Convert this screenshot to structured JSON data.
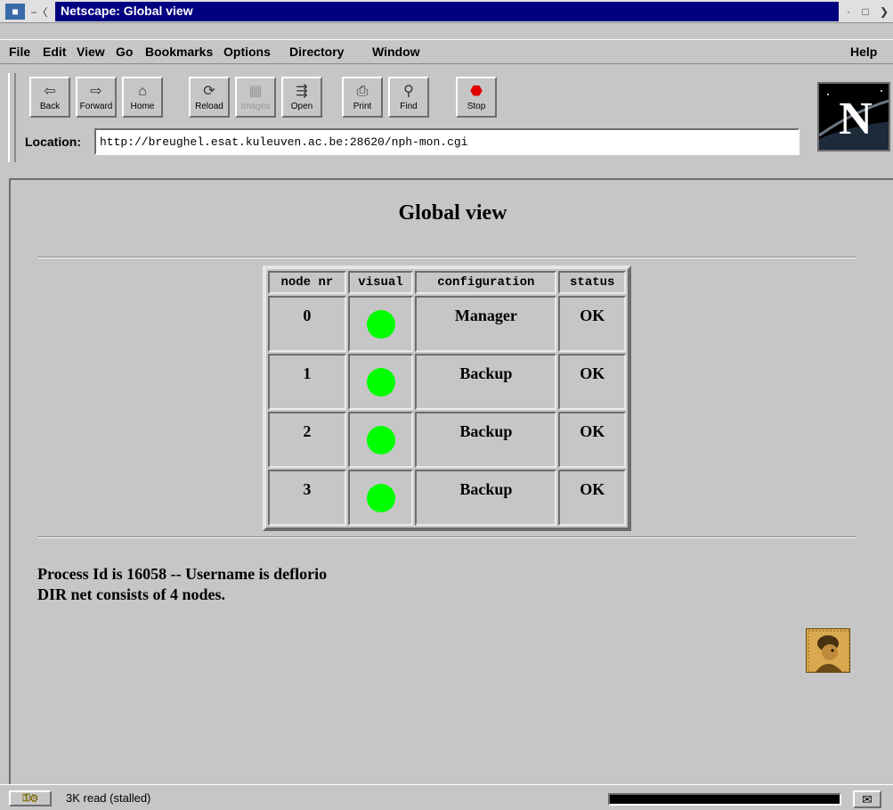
{
  "window": {
    "title": "Netscape: Global view"
  },
  "menubar": {
    "items": [
      "File",
      "Edit",
      "View",
      "Go",
      "Bookmarks",
      "Options",
      "Directory",
      "Window"
    ],
    "help": "Help"
  },
  "toolbar": {
    "buttons": [
      {
        "label": "Back",
        "icon": "back-arrow-icon"
      },
      {
        "label": "Forward",
        "icon": "forward-arrow-icon"
      },
      {
        "label": "Home",
        "icon": "home-icon"
      },
      {
        "label": "Reload",
        "icon": "reload-icon"
      },
      {
        "label": "Images",
        "icon": "images-icon",
        "disabled": true
      },
      {
        "label": "Open",
        "icon": "open-icon"
      },
      {
        "label": "Print",
        "icon": "print-icon"
      },
      {
        "label": "Find",
        "icon": "find-icon"
      },
      {
        "label": "Stop",
        "icon": "stop-icon"
      }
    ]
  },
  "location": {
    "label": "Location:",
    "url": "http://breughel.esat.kuleuven.ac.be:28620/nph-mon.cgi"
  },
  "page": {
    "title": "Global view",
    "table": {
      "headers": [
        "node nr",
        "visual",
        "configuration",
        "status"
      ],
      "rows": [
        {
          "node": "0",
          "configuration": "Manager",
          "status": "OK"
        },
        {
          "node": "1",
          "configuration": "Backup",
          "status": "OK"
        },
        {
          "node": "2",
          "configuration": "Backup",
          "status": "OK"
        },
        {
          "node": "3",
          "configuration": "Backup",
          "status": "OK"
        }
      ],
      "status_color": "#00ff00"
    },
    "info_line_1": "Process Id is 16058 -- Username is deflorio",
    "info_line_2": "DIR net consists of 4 nodes."
  },
  "statusbar": {
    "text": "3K read (stalled)",
    "progress": 1.0
  }
}
